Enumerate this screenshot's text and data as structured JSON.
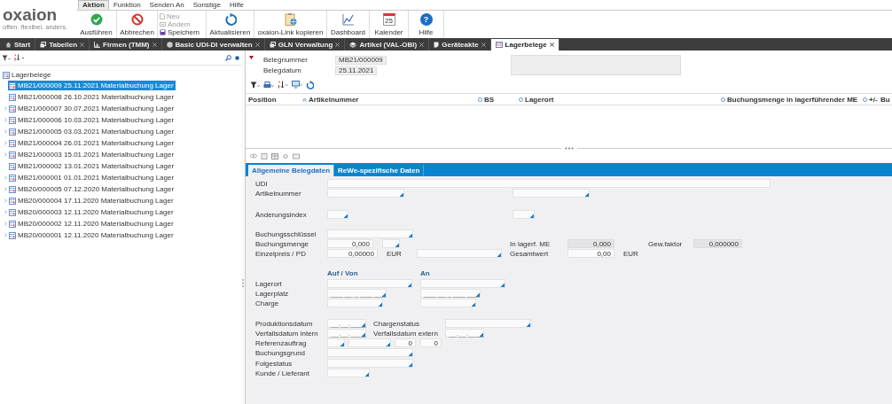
{
  "menu": [
    {
      "label": "Aktion",
      "selected": true
    },
    {
      "label": "Funktion",
      "selected": false
    },
    {
      "label": "Senden An",
      "selected": false
    },
    {
      "label": "Sonstige",
      "selected": false
    },
    {
      "label": "Hilfe",
      "selected": false
    }
  ],
  "logo": {
    "name": "oxaion",
    "tagline": "offen. flexibel. anders."
  },
  "ribbon": [
    {
      "kind": "big",
      "label": "Ausführen"
    },
    {
      "kind": "big",
      "label": "Abbrechen"
    },
    {
      "kind": "stack",
      "items": [
        {
          "label": "Neu",
          "disabled": true
        },
        {
          "label": "Ändern",
          "disabled": true
        },
        {
          "label": "Speichern",
          "disabled": false
        }
      ]
    },
    {
      "kind": "big",
      "label": "Aktualisieren"
    },
    {
      "kind": "big",
      "label": "oxaion-Link kopieren"
    },
    {
      "kind": "big",
      "label": "Dashboard"
    },
    {
      "kind": "big",
      "icon_text": "25",
      "label": "Kalender"
    },
    {
      "kind": "big",
      "icon_text": "?",
      "label": "Hilfe"
    }
  ],
  "tabs": [
    {
      "label": "Start",
      "closable": false,
      "selected": false
    },
    {
      "label": "Tabellen",
      "closable": true,
      "selected": false
    },
    {
      "label": "Firmen (TMM)",
      "closable": true,
      "selected": false
    },
    {
      "label": "Basic UDI-DI verwalten",
      "closable": true,
      "selected": false
    },
    {
      "label": "GLN Verwaltung",
      "closable": true,
      "selected": false
    },
    {
      "label": "Artikel (VAL-OBI)",
      "closable": true,
      "selected": false
    },
    {
      "label": "Geräteakte",
      "closable": true,
      "selected": false
    },
    {
      "label": "Lagerbelege",
      "closable": true,
      "selected": true
    }
  ],
  "tree": {
    "label": "Lagerbelege",
    "children": [
      {
        "label": "MB21/000009 25.11.2021 Materialbuchung Lager",
        "selected": true,
        "expandable": false
      },
      {
        "label": "MB21/000008 26.10.2021 Materialbuchung Lager",
        "selected": false,
        "expandable": false
      },
      {
        "label": "MB21/000007 30.07.2021 Materialbuchung Lager",
        "selected": false,
        "expandable": true
      },
      {
        "label": "MB21/000006 10.03.2021 Materialbuchung Lager",
        "selected": false,
        "expandable": true
      },
      {
        "label": "MB21/000005 03.03.2021 Materialbuchung Lager",
        "selected": false,
        "expandable": true
      },
      {
        "label": "MB21/000004 26.01.2021 Materialbuchung Lager",
        "selected": false,
        "expandable": true
      },
      {
        "label": "MB21/000003 15.01.2021 Materialbuchung Lager",
        "selected": false,
        "expandable": true
      },
      {
        "label": "MB21/000002 13.01.2021 Materialbuchung Lager",
        "selected": false,
        "expandable": false
      },
      {
        "label": "MB21/000001 01.01.2021 Materialbuchung Lager",
        "selected": false,
        "expandable": true
      },
      {
        "label": "MB20/000005 07.12.2020 Materialbuchung Lager",
        "selected": false,
        "expandable": true
      },
      {
        "label": "MB20/000004 17.11.2020 Materialbuchung Lager",
        "selected": false,
        "expandable": true
      },
      {
        "label": "MB20/000003 12.11.2020 Materialbuchung Lager",
        "selected": false,
        "expandable": true
      },
      {
        "label": "MB20/000002 12.11.2020 Materialbuchung Lager",
        "selected": false,
        "expandable": true
      },
      {
        "label": "MB20/000001 12.11.2020 Materialbuchung Lager",
        "selected": false,
        "expandable": true
      }
    ]
  },
  "header_fields": [
    {
      "label": "Belegnummer",
      "value": "MB21/000009"
    },
    {
      "label": "Belegdatum",
      "value": "25.11.2021"
    }
  ],
  "table": {
    "columns": [
      {
        "label": "Position",
        "kind": "plain"
      },
      {
        "label": "Artikelnummer",
        "kind": "sorted"
      },
      {
        "label": "BS",
        "kind": "option"
      },
      {
        "label": "Lagerort",
        "kind": "option"
      },
      {
        "label": "Buchungsmenge in lagerführender ME",
        "kind": "option"
      },
      {
        "label": "+/-",
        "kind": "option"
      },
      {
        "label": "Bu",
        "kind": "plain"
      }
    ]
  },
  "detail_tabs": [
    {
      "label": "Allgemeine Belegdaten",
      "selected": true
    },
    {
      "label": "ReWe-spezifische Daten",
      "selected": false
    }
  ],
  "form": {
    "rows": [
      {
        "cells": [
          {
            "kind": "label",
            "text": "UDI"
          },
          {
            "kind": "input"
          }
        ]
      },
      {
        "cells": [
          {
            "kind": "label",
            "text": "Artikelnummer"
          },
          {
            "kind": "select"
          },
          {
            "kind": "select"
          }
        ]
      },
      {
        "cells": [
          {
            "kind": "label",
            "text": "Änderungsindex"
          },
          {
            "kind": "select"
          },
          {
            "kind": "select"
          }
        ]
      },
      {
        "cells": [
          {
            "kind": "label",
            "text": "Buchungsschlüssel"
          },
          {
            "kind": "select"
          }
        ]
      },
      {
        "cells": [
          {
            "kind": "label",
            "text": "Buchungsmenge"
          },
          {
            "kind": "input",
            "value": "0,000"
          },
          {
            "kind": "select"
          },
          {
            "kind": "empty"
          },
          {
            "kind": "label",
            "text": "In lagerf. ME"
          },
          {
            "kind": "readonly",
            "value": "0,000"
          },
          {
            "kind": "label",
            "text": "Gew.faktor"
          },
          {
            "kind": "readonly",
            "value": "0,000000"
          }
        ]
      },
      {
        "cells": [
          {
            "kind": "label",
            "text": "Einzelpreis  / PD"
          },
          {
            "kind": "input",
            "value": "0,00000"
          },
          {
            "kind": "label",
            "text": "EUR"
          },
          {
            "kind": "select"
          },
          {
            "kind": "label",
            "text": "Gesamtwert"
          },
          {
            "kind": "input",
            "value": "0,00"
          },
          {
            "kind": "label",
            "text": "EUR"
          }
        ]
      },
      {
        "cells": [
          {
            "kind": "empty"
          },
          {
            "kind": "heading",
            "text": "Auf / Von"
          },
          {
            "kind": "heading",
            "text": "An"
          }
        ]
      },
      {
        "cells": [
          {
            "kind": "label",
            "text": "Lagerort"
          },
          {
            "kind": "select"
          },
          {
            "kind": "select"
          }
        ]
      },
      {
        "cells": [
          {
            "kind": "label",
            "text": "Lagerplatz"
          },
          {
            "kind": "select",
            "placeholder": "___ __ _ ___ ___"
          },
          {
            "kind": "select",
            "placeholder": "___ __ _ ___ ___"
          }
        ]
      },
      {
        "cells": [
          {
            "kind": "label",
            "text": "Charge"
          },
          {
            "kind": "select"
          },
          {
            "kind": "select"
          }
        ]
      },
      {
        "cells": [
          {
            "kind": "label",
            "text": "Produktionsdatum"
          },
          {
            "kind": "date",
            "placeholder": "__.__.____"
          },
          {
            "kind": "label",
            "text": "Chargenstatus"
          },
          {
            "kind": "select"
          }
        ]
      },
      {
        "cells": [
          {
            "kind": "label",
            "text": "Verfallsdatum intern"
          },
          {
            "kind": "date",
            "placeholder": "__.__.____"
          },
          {
            "kind": "label",
            "text": "Verfallsdatum extern"
          },
          {
            "kind": "date",
            "placeholder": "__.__.____"
          }
        ]
      },
      {
        "cells": [
          {
            "kind": "label",
            "text": "Referenzauftrag"
          },
          {
            "kind": "select"
          },
          {
            "kind": "select"
          },
          {
            "kind": "input",
            "value": "0"
          },
          {
            "kind": "input",
            "value": "0"
          }
        ]
      },
      {
        "cells": [
          {
            "kind": "label",
            "text": "Buchungsgrund"
          },
          {
            "kind": "select"
          }
        ]
      },
      {
        "cells": [
          {
            "kind": "label",
            "text": "Folgestatus"
          },
          {
            "kind": "select"
          }
        ]
      },
      {
        "cells": [
          {
            "kind": "label",
            "text": "Kunde / Lieferant"
          },
          {
            "kind": "select"
          }
        ]
      }
    ]
  }
}
